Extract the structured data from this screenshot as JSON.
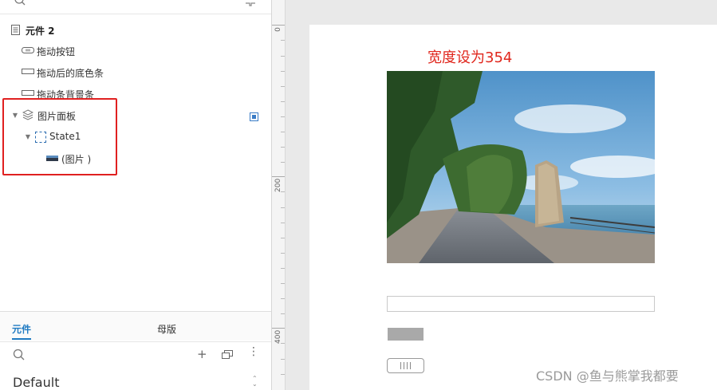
{
  "outline": {
    "items": [
      {
        "label": "元件 2",
        "icon": "page-icon"
      },
      {
        "label": "拖动按钮",
        "icon": "button-shape-icon"
      },
      {
        "label": "拖动后的底色条",
        "icon": "rectangle-icon"
      },
      {
        "label": "拖动条背景条",
        "icon": "rectangle-icon"
      },
      {
        "label": "图片面板",
        "icon": "layers-icon",
        "expanded": true
      },
      {
        "label": "State1",
        "icon": "state-icon",
        "expanded": true
      },
      {
        "label": "(图片 )",
        "icon": "image-icon"
      }
    ]
  },
  "library": {
    "tabs": [
      "元件",
      "母版"
    ],
    "active_tab": "元件",
    "select_value": "Default"
  },
  "ruler": {
    "labels": [
      "0",
      "200",
      "400"
    ]
  },
  "canvas": {
    "annotation": "宽度设为354",
    "annotation_color": "#e0261c",
    "photo_alt": "image-photo-lakeside"
  },
  "watermark": "CSDN @鱼与熊掌我都要",
  "colors": {
    "accent": "#1f7ac2",
    "highlight": "#e02020"
  }
}
